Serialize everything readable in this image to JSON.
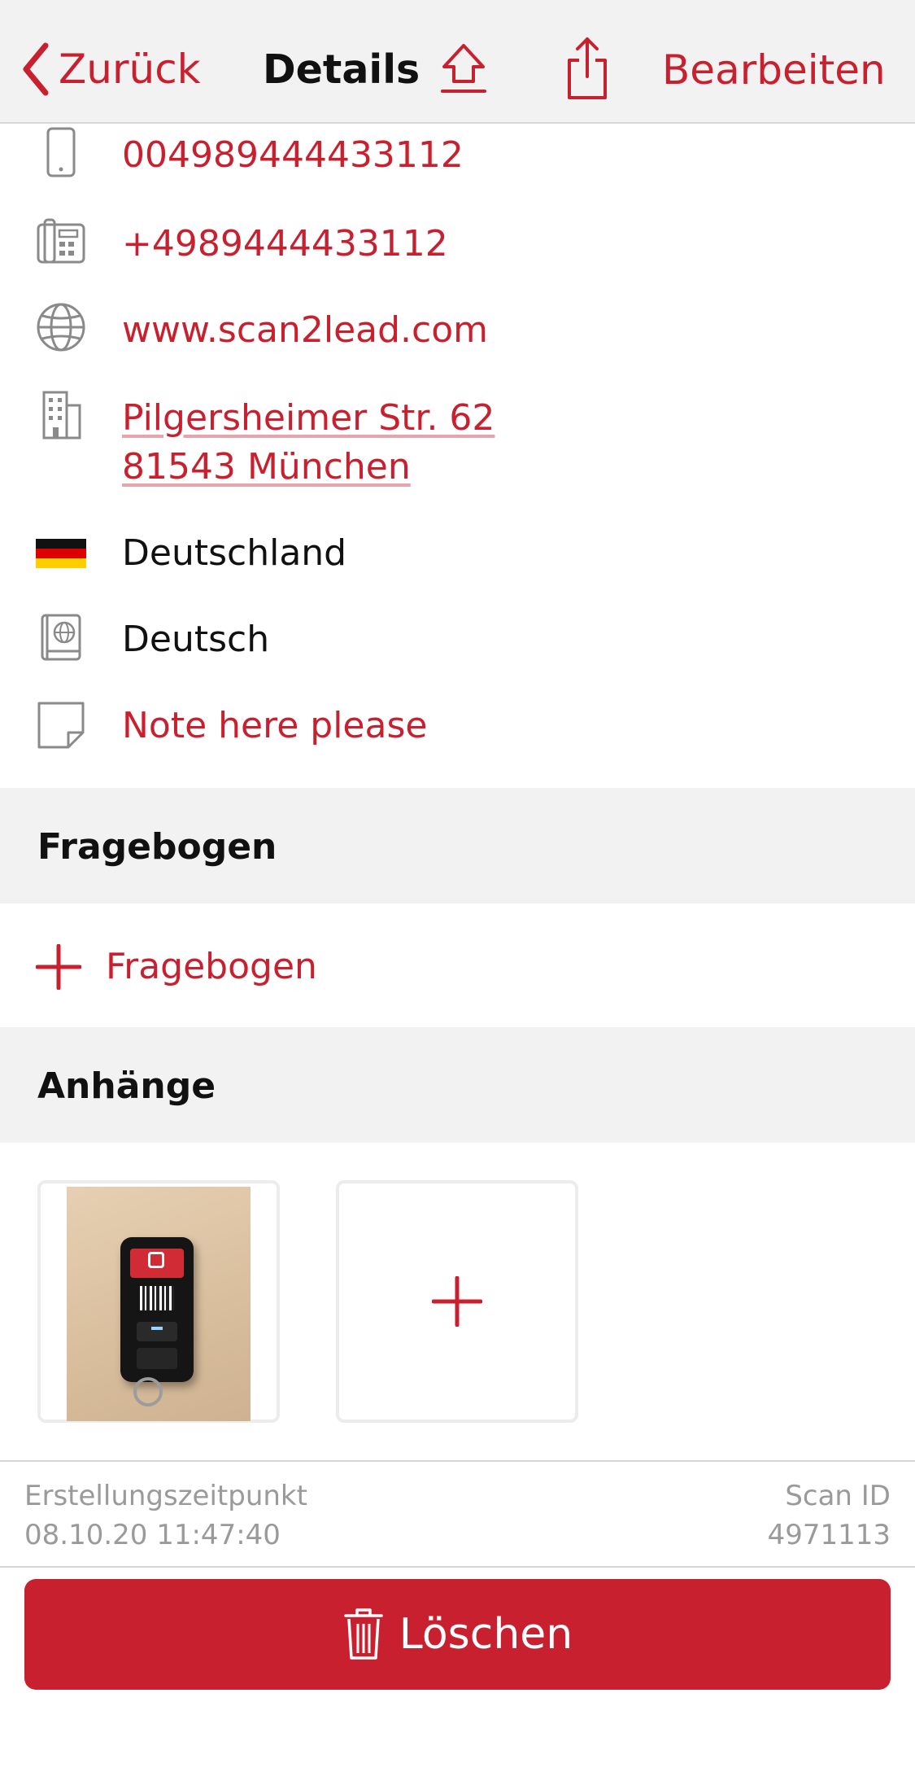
{
  "navbar": {
    "back_label": "Zurück",
    "title": "Details",
    "edit_label": "Bearbeiten"
  },
  "details": {
    "mobile": "004989444433112",
    "phone": "+4989444433112",
    "website": "www.scan2lead.com",
    "address_line1": "Pilgersheimer Str. 62",
    "address_line2": "81543 München",
    "country": "Deutschland",
    "language": "Deutsch",
    "note": "Note here please"
  },
  "questionnaire": {
    "header": "Fragebogen",
    "add_label": "Fragebogen"
  },
  "attachments": {
    "header": "Anhänge"
  },
  "meta": {
    "created_label": "Erstellungszeitpunkt",
    "created_value": "08.10.20 11:47:40",
    "scan_id_label": "Scan ID",
    "scan_id_value": "4971113"
  },
  "actions": {
    "delete_label": "Löschen"
  },
  "colors": {
    "accent": "#C8202E",
    "section_bg": "#f2f2f2",
    "icon_gray": "#8a8a8a"
  },
  "icons": [
    "chevron-left-icon",
    "upload-icon",
    "share-icon",
    "mobile-phone-icon",
    "desk-phone-icon",
    "globe-icon",
    "building-icon",
    "germany-flag-icon",
    "language-book-icon",
    "note-icon",
    "plus-icon",
    "trash-icon"
  ]
}
